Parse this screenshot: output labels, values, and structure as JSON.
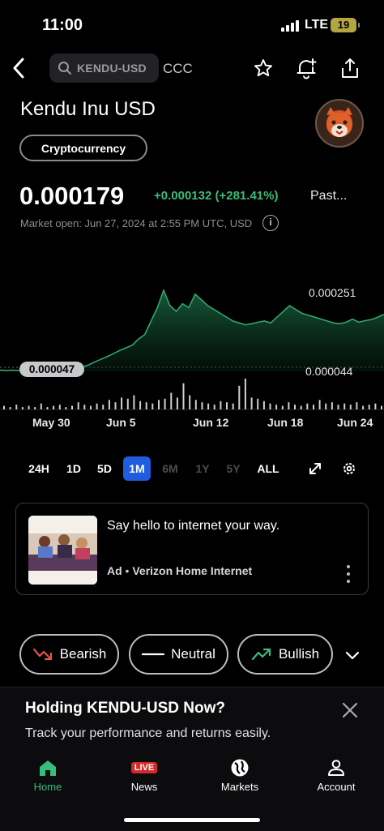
{
  "status_bar": {
    "time": "11:00",
    "network": "LTE",
    "battery": "19"
  },
  "nav": {
    "search_query": "KENDU-USD",
    "exchange": "CCC"
  },
  "header": {
    "title": "Kendu Inu USD",
    "category": "Cryptocurrency",
    "price": "0.000179",
    "change": "+0.000132 (+281.41%)",
    "period_label": "Past...",
    "market_status": "Market open: Jun 27, 2024 at 2:55 PM UTC, USD"
  },
  "chart_data": {
    "type": "area",
    "high_label": "0.000251",
    "low_label": "0.000044",
    "start_label": "0.000047",
    "x_ticks": [
      "May 30",
      "Jun 5",
      "Jun 12",
      "Jun 18",
      "Jun 24"
    ],
    "series": [
      {
        "values": [
          4.7e-05,
          4.6e-05,
          4.7e-05,
          4.6e-05,
          4.8e-05,
          4.7e-05,
          4.6e-05,
          4.7e-05,
          4.8e-05,
          4.7e-05,
          4.9e-05,
          5e-05,
          5.2e-05,
          5.5e-05,
          6e-05,
          6.8e-05,
          7.5e-05,
          8.2e-05,
          9e-05,
          9.8e-05,
          0.000105,
          0.000112,
          0.000128,
          0.00014,
          0.000175,
          0.00021,
          0.000255,
          0.000215,
          0.0002,
          0.00022,
          0.00021,
          0.000245,
          0.00023,
          0.000215,
          0.000205,
          0.000195,
          0.000185,
          0.000175,
          0.00017,
          0.000165,
          0.000168,
          0.000172,
          0.000175,
          0.00017,
          0.000185,
          0.0002,
          0.000215,
          0.000205,
          0.000195,
          0.00019,
          0.000185,
          0.00018,
          0.000175,
          0.00017,
          0.000168,
          0.000172,
          0.00018,
          0.000172,
          0.000176,
          0.000179,
          0.000185,
          0.000192
        ]
      }
    ],
    "volume": [
      3,
      2,
      4,
      2,
      3,
      2,
      5,
      2,
      3,
      4,
      2,
      3,
      6,
      4,
      3,
      5,
      4,
      8,
      6,
      10,
      9,
      12,
      7,
      6,
      5,
      8,
      9,
      14,
      10,
      22,
      12,
      8,
      6,
      5,
      4,
      7,
      6,
      5,
      20,
      26,
      10,
      9,
      7,
      5,
      4,
      3,
      6,
      4,
      3,
      5,
      4,
      8,
      5,
      6,
      4,
      5,
      4,
      6,
      3,
      4,
      5,
      3
    ],
    "ylim": [
      4.4e-05,
      0.000251
    ],
    "grid": false,
    "color": "#2fa86c"
  },
  "ranges": [
    {
      "label": "24H",
      "state": "normal"
    },
    {
      "label": "1D",
      "state": "normal"
    },
    {
      "label": "5D",
      "state": "normal"
    },
    {
      "label": "1M",
      "state": "active"
    },
    {
      "label": "6M",
      "state": "dim"
    },
    {
      "label": "1Y",
      "state": "dim"
    },
    {
      "label": "5Y",
      "state": "dim"
    },
    {
      "label": "ALL",
      "state": "normal"
    }
  ],
  "ad": {
    "headline": "Say hello to internet your way.",
    "tag": "Ad",
    "sponsor": "Verizon Home Internet"
  },
  "sentiment": {
    "bearish": "Bearish",
    "neutral": "Neutral",
    "bullish": "Bullish"
  },
  "holding": {
    "title": "Holding KENDU-USD Now?",
    "subtitle": "Track your performance and returns easily."
  },
  "tabs": {
    "home": "Home",
    "news": "News",
    "news_badge": "LIVE",
    "markets": "Markets",
    "account": "Account"
  },
  "colors": {
    "accent": "#1f5ce0",
    "positive": "#3bbd7a",
    "bearish": "#e0564a"
  }
}
